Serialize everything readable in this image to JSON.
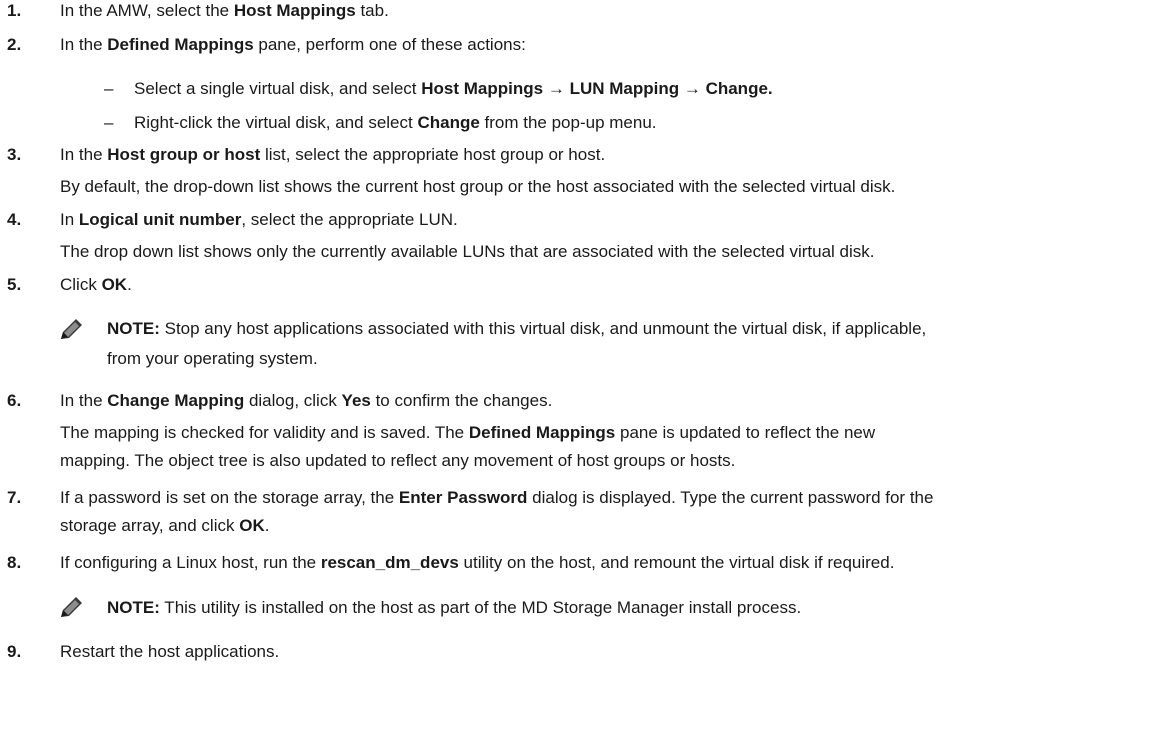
{
  "steps": [
    {
      "num": "1.",
      "t1": "In the AMW, select the ",
      "b1": "Host Mappings",
      "t2": " tab."
    },
    {
      "num": "2.",
      "t1": "In the ",
      "b1": "Defined Mappings",
      "t2": " pane, perform one of these actions:"
    },
    {
      "num": "3.",
      "t1": "In the ",
      "b1": "Host group or host",
      "t2": " list, select the appropriate host group or host."
    },
    {
      "num": "4.",
      "t1": "In ",
      "b1": "Logical unit number",
      "t2": ", select the appropriate LUN."
    },
    {
      "num": "5.",
      "t1": "Click ",
      "b1": "OK",
      "t2": "."
    },
    {
      "num": "6.",
      "t1": "In the ",
      "b1": "Change Mapping",
      "t2": " dialog, click ",
      "b2": "Yes",
      "t3": " to confirm the changes."
    },
    {
      "num": "7.",
      "t1": "If a password is set on the storage array, the ",
      "b1": "Enter Password",
      "t2": " dialog is displayed. Type the current password for the",
      "line2a": "storage array, and click ",
      "line2b": "OK",
      "line2c": "."
    },
    {
      "num": "8.",
      "t1": "If configuring a Linux host, run the ",
      "b1": "rescan_dm_devs",
      "t2": " utility on the host, and remount the virtual disk if required."
    },
    {
      "num": "9.",
      "t1": "Restart the host applications."
    }
  ],
  "sub_items": [
    {
      "dash": "–",
      "t1": "Select a single virtual disk, and select ",
      "b1": "Host Mappings",
      "a1": " → ",
      "b2": "LUN Mapping",
      "a2": " → ",
      "b3": "Change."
    },
    {
      "dash": "–",
      "t1": "Right-click the virtual disk, and select ",
      "b1": "Change",
      "t2": " from the pop-up menu."
    }
  ],
  "paragraphs": {
    "p3": "By default, the drop-down list shows the current host group or the host associated with the selected virtual disk.",
    "p4": "The drop down list shows only the currently available LUNs that are associated with the selected virtual disk.",
    "p6a_1": "The mapping is checked for validity and is saved. The ",
    "p6a_b": "Defined Mappings",
    "p6a_2": " pane is updated to reflect the new",
    "p6b": "mapping. The object tree is also updated to reflect any movement of host groups or hosts."
  },
  "notes": [
    {
      "label": "NOTE:",
      "line1": " Stop any host applications associated with this virtual disk, and unmount the virtual disk, if applicable,",
      "line2": "from your operating system."
    },
    {
      "label": "NOTE:",
      "line1": " This utility is installed on the host as part of the MD Storage Manager install process."
    }
  ]
}
